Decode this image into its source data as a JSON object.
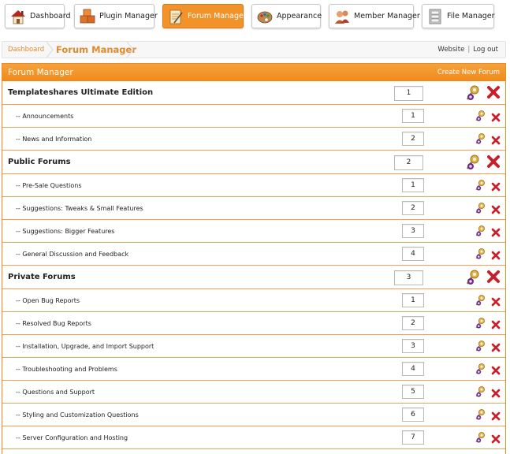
{
  "nav": [
    {
      "label": "Dashboard",
      "icon": "house-icon",
      "active": false
    },
    {
      "label": "Plugin Manager",
      "icon": "boxes-icon",
      "active": false
    },
    {
      "label": "Forum Manager",
      "icon": "notepad-icon",
      "active": true
    },
    {
      "label": "Appearance",
      "icon": "palette-icon",
      "active": false
    },
    {
      "label": "Member Manager",
      "icon": "members-icon",
      "active": false
    },
    {
      "label": "File Manager",
      "icon": "file-cabinet-icon",
      "active": false
    }
  ],
  "breadcrumb": {
    "root": "Dashboard",
    "current": "Forum Manager"
  },
  "top_links": {
    "website": "Website",
    "separator": "|",
    "logout": "Log out"
  },
  "panel": {
    "title": "Forum Manager",
    "create_link": "Create New Forum"
  },
  "forums": [
    {
      "type": "category",
      "name": "Templateshares Ultimate Edition",
      "order": "1"
    },
    {
      "type": "forum",
      "name": "-- Announcements",
      "order": "1"
    },
    {
      "type": "forum",
      "name": "-- News and Information",
      "order": "2"
    },
    {
      "type": "category",
      "name": "Public Forums",
      "order": "2"
    },
    {
      "type": "forum",
      "name": "-- Pre-Sale Questions",
      "order": "1"
    },
    {
      "type": "forum",
      "name": "-- Suggestions: Tweaks & Small Features",
      "order": "2"
    },
    {
      "type": "forum",
      "name": "-- Suggestions: Bigger Features",
      "order": "3"
    },
    {
      "type": "forum",
      "name": "-- General Discussion and Feedback",
      "order": "4"
    },
    {
      "type": "category",
      "name": "Private Forums",
      "order": "3"
    },
    {
      "type": "forum",
      "name": "-- Open Bug Reports",
      "order": "1"
    },
    {
      "type": "forum",
      "name": "-- Resolved Bug Reports",
      "order": "2"
    },
    {
      "type": "forum",
      "name": "-- Installation, Upgrade, and Import Support",
      "order": "3"
    },
    {
      "type": "forum",
      "name": "-- Troubleshooting and Problems",
      "order": "4"
    },
    {
      "type": "forum",
      "name": "-- Questions and Support",
      "order": "5"
    },
    {
      "type": "forum",
      "name": "-- Styling and Customization Questions",
      "order": "6"
    },
    {
      "type": "forum",
      "name": "-- Server Configuration and Hosting",
      "order": "7"
    }
  ],
  "colors": {
    "accent": "#ef8a1c",
    "breadcrumb": "#e28a2b",
    "delete": "#c8202a"
  }
}
